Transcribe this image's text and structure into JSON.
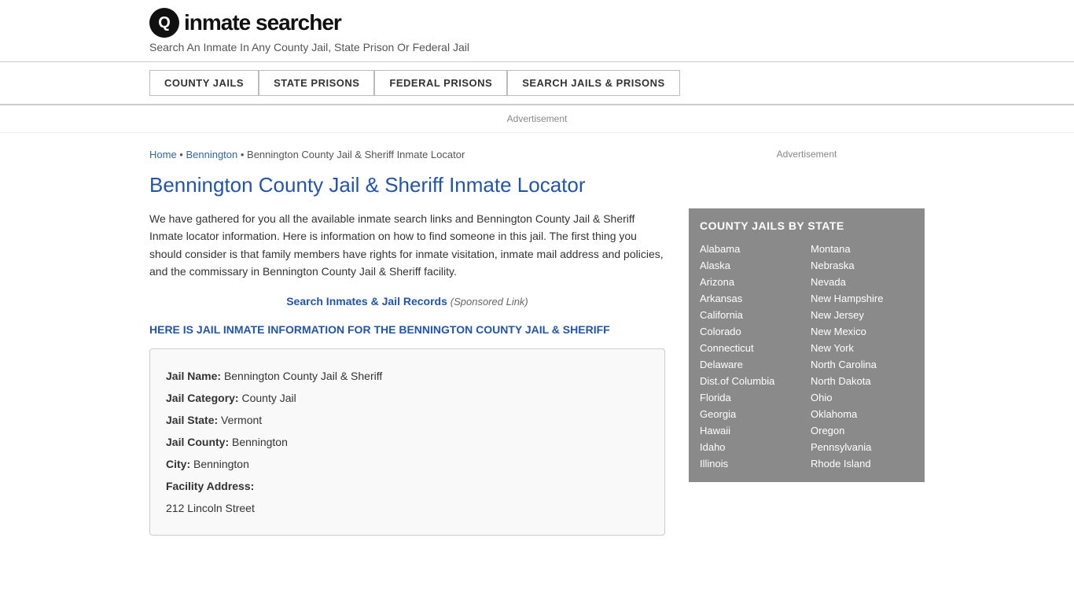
{
  "header": {
    "logo_icon": "🔍",
    "logo_text": "inmate searcher",
    "tagline": "Search An Inmate In Any County Jail, State Prison Or Federal Jail"
  },
  "nav": {
    "buttons": [
      {
        "label": "COUNTY JAILS"
      },
      {
        "label": "STATE PRISONS"
      },
      {
        "label": "FEDERAL PRISONS"
      },
      {
        "label": "SEARCH JAILS & PRISONS"
      }
    ]
  },
  "ad_banner": "Advertisement",
  "breadcrumb": {
    "home": "Home",
    "city": "Bennington",
    "current": "Bennington County Jail & Sheriff Inmate Locator"
  },
  "page_title": "Bennington County Jail & Sheriff Inmate Locator",
  "description": "We have gathered for you all the available inmate search links and Bennington County Jail & Sheriff Inmate locator information. Here is information on how to find someone in this jail. The first thing you should consider is that family members have rights for inmate visitation, inmate mail address and policies, and the commissary in Bennington County Jail & Sheriff facility.",
  "sponsored": {
    "link_text": "Search Inmates & Jail Records",
    "note": "(Sponsored Link)"
  },
  "info_heading": "HERE IS JAIL INMATE INFORMATION FOR THE BENNINGTON COUNTY JAIL & SHERIFF",
  "jail_info": {
    "name_label": "Jail Name:",
    "name_value": "Bennington County Jail & Sheriff",
    "category_label": "Jail Category:",
    "category_value": "County Jail",
    "state_label": "Jail State:",
    "state_value": "Vermont",
    "county_label": "Jail County:",
    "county_value": "Bennington",
    "city_label": "City:",
    "city_value": "Bennington",
    "address_label": "Facility Address:",
    "address_value": "212 Lincoln Street"
  },
  "sidebar": {
    "ad_text": "Advertisement",
    "state_box_title": "COUNTY JAILS BY STATE",
    "states_left": [
      "Alabama",
      "Alaska",
      "Arizona",
      "Arkansas",
      "California",
      "Colorado",
      "Connecticut",
      "Delaware",
      "Dist.of Columbia",
      "Florida",
      "Georgia",
      "Hawaii",
      "Idaho",
      "Illinois"
    ],
    "states_right": [
      "Montana",
      "Nebraska",
      "Nevada",
      "New Hampshire",
      "New Jersey",
      "New Mexico",
      "New York",
      "North Carolina",
      "North Dakota",
      "Ohio",
      "Oklahoma",
      "Oregon",
      "Pennsylvania",
      "Rhode Island"
    ]
  }
}
